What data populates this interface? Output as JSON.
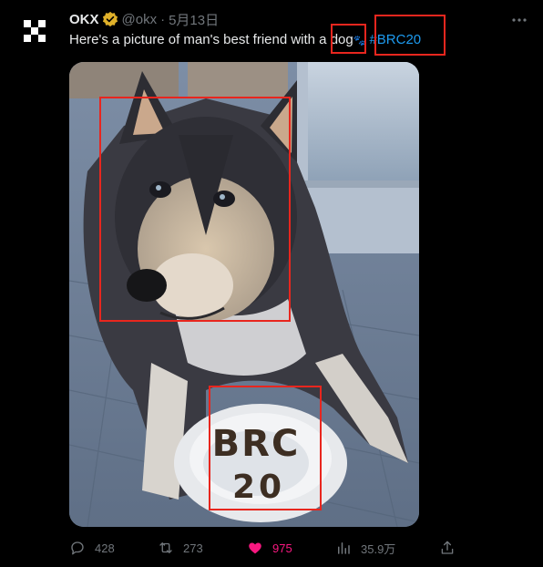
{
  "tweet": {
    "author_name": "OKX",
    "handle": "@okx",
    "separator": "·",
    "date": "5月13日",
    "text_before": "Here's a picture of man's best friend with a ",
    "text_keyword": "dog",
    "text_tail": "🐾",
    "hashtag": "#BRC20"
  },
  "image": {
    "bowl_text_line1": "BRC",
    "bowl_text_line2": "20"
  },
  "actions": {
    "replies": "428",
    "reposts": "273",
    "likes": "975",
    "views": "35.9万"
  },
  "colors": {
    "background": "#000000",
    "text": "#e7e9ea",
    "muted": "#71767b",
    "link": "#1d9bf0",
    "like": "#f91880",
    "highlight_box": "#e8261e",
    "verified": "#e0b12a"
  },
  "icons": {
    "avatar": "okx-logo-icon",
    "verified": "verified-badge-icon",
    "more": "more-options-icon",
    "reply": "reply-icon",
    "repost": "repost-icon",
    "like": "heart-icon",
    "views": "views-chart-icon",
    "share": "share-icon"
  }
}
